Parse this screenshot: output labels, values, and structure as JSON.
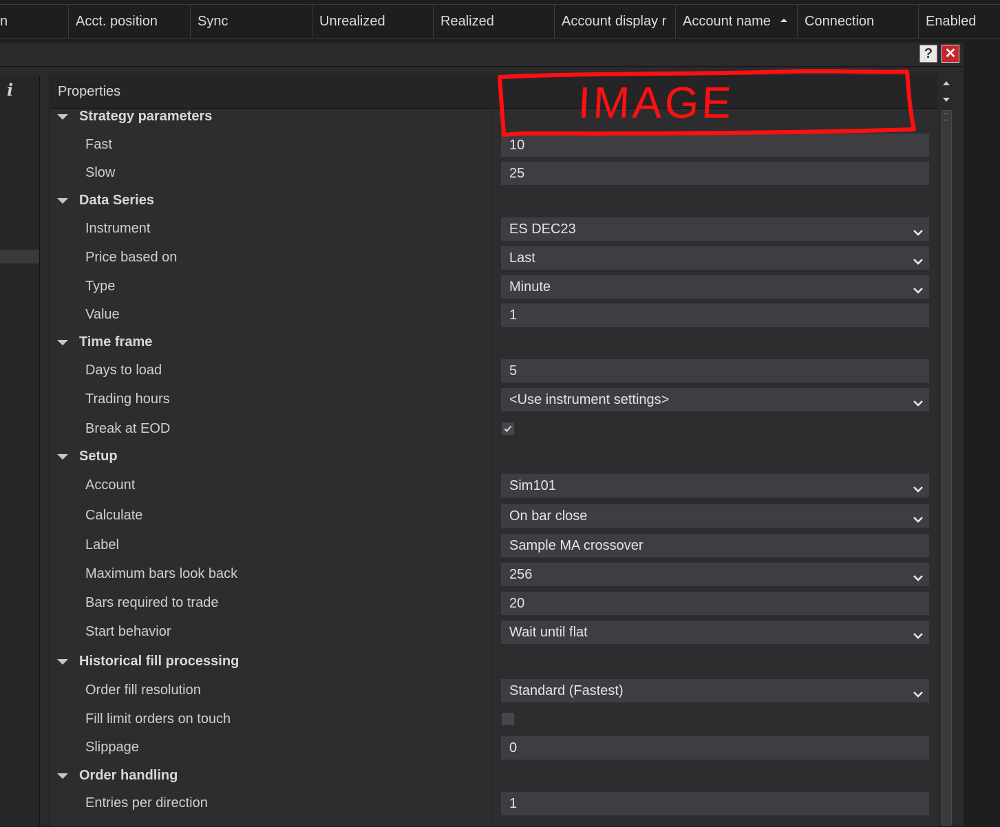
{
  "grid_header": {
    "columns": [
      {
        "label": "n"
      },
      {
        "label": "Acct. position"
      },
      {
        "label": "Sync"
      },
      {
        "label": "Unrealized"
      },
      {
        "label": "Realized"
      },
      {
        "label": "Account display r"
      },
      {
        "label": "Account name",
        "sorted": "ascending"
      },
      {
        "label": "Connection"
      },
      {
        "label": "Enabled"
      }
    ]
  },
  "dialog": {
    "help_label": "?",
    "close_label": "✕",
    "info_icon_label": "i"
  },
  "properties": {
    "header": "Properties",
    "rows": [
      {
        "kind": "category",
        "label": "Strategy parameters",
        "expanded": true
      },
      {
        "kind": "prop",
        "label": "Fast",
        "value": "10",
        "editor": "text"
      },
      {
        "kind": "prop",
        "label": "Slow",
        "value": "25",
        "editor": "text"
      },
      {
        "kind": "category",
        "label": "Data Series",
        "expanded": true
      },
      {
        "kind": "prop",
        "label": "Instrument",
        "value": "ES DEC23",
        "editor": "dropdown"
      },
      {
        "kind": "prop",
        "label": "Price based on",
        "value": "Last",
        "editor": "dropdown"
      },
      {
        "kind": "prop",
        "label": "Type",
        "value": "Minute",
        "editor": "dropdown"
      },
      {
        "kind": "prop",
        "label": "Value",
        "value": "1",
        "editor": "text"
      },
      {
        "kind": "category",
        "label": "Time frame",
        "expanded": true
      },
      {
        "kind": "prop",
        "label": "Days to load",
        "value": "5",
        "editor": "text"
      },
      {
        "kind": "prop",
        "label": "Trading hours",
        "value": "<Use instrument settings>",
        "editor": "dropdown"
      },
      {
        "kind": "prop",
        "label": "Break at EOD",
        "value": true,
        "editor": "checkbox"
      },
      {
        "kind": "category",
        "label": "Setup",
        "expanded": true
      },
      {
        "kind": "prop",
        "label": "Account",
        "value": "Sim101",
        "editor": "dropdown"
      },
      {
        "kind": "prop",
        "label": "Calculate",
        "value": "On bar close",
        "editor": "dropdown"
      },
      {
        "kind": "prop",
        "label": "Label",
        "value": "Sample MA crossover",
        "editor": "text"
      },
      {
        "kind": "prop",
        "label": "Maximum bars look back",
        "value": "256",
        "editor": "dropdown"
      },
      {
        "kind": "prop",
        "label": "Bars required to trade",
        "value": "20",
        "editor": "text"
      },
      {
        "kind": "prop",
        "label": "Start behavior",
        "value": "Wait until flat",
        "editor": "dropdown"
      },
      {
        "kind": "category",
        "label": "Historical fill processing",
        "expanded": true
      },
      {
        "kind": "prop",
        "label": "Order fill resolution",
        "value": "Standard (Fastest)",
        "editor": "dropdown"
      },
      {
        "kind": "prop",
        "label": "Fill limit orders on touch",
        "value": false,
        "editor": "checkbox"
      },
      {
        "kind": "prop",
        "label": "Slippage",
        "value": "0",
        "editor": "text"
      },
      {
        "kind": "category",
        "label": "Order handling",
        "expanded": true
      },
      {
        "kind": "prop",
        "label": "Entries per direction",
        "value": "1",
        "editor": "text"
      }
    ]
  },
  "annotation": {
    "text": "IMAGE",
    "color": "#ff1010"
  },
  "colors": {
    "background": "#1e1e1e",
    "panel": "#2d2d30",
    "value_field": "#3e3e42",
    "close_button": "#c9242a"
  }
}
